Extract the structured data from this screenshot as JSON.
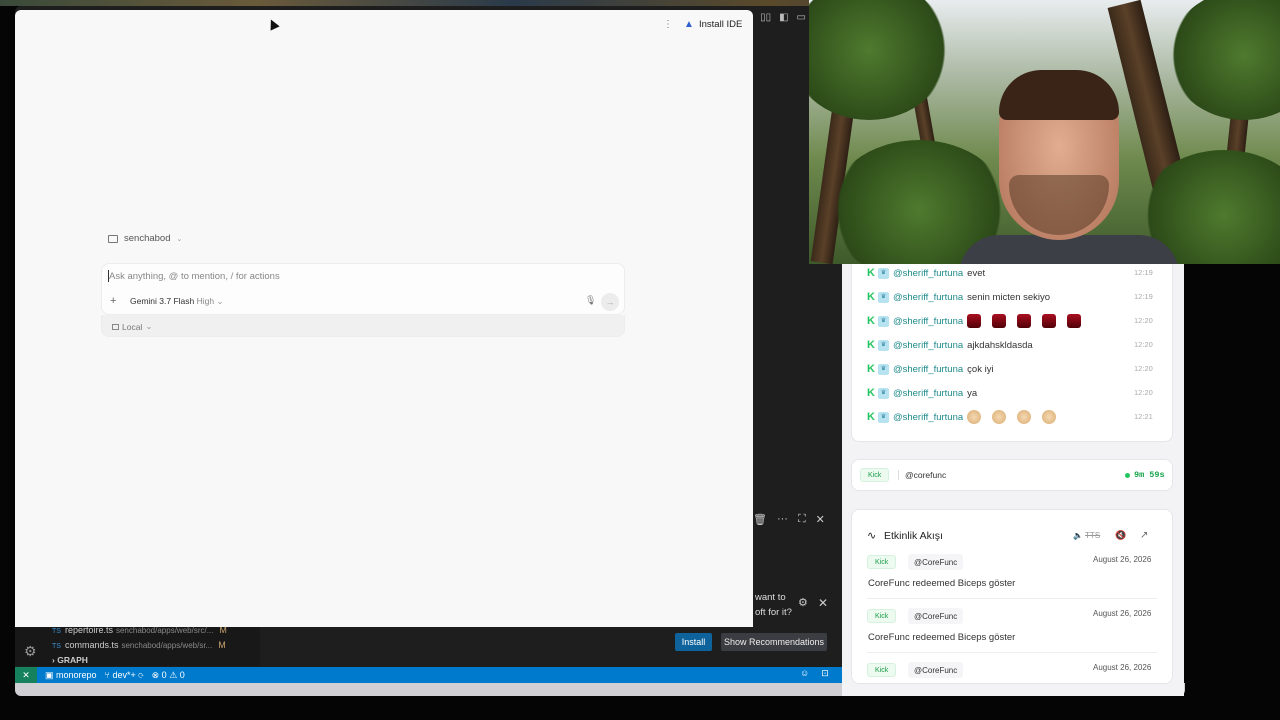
{
  "ai_window": {
    "menu_icon": "kebab-icon",
    "install_ide_label": "Install IDE",
    "workspace_name": "senchabod",
    "prompt_placeholder": "Ask anything, @ to mention, / for actions",
    "model_name": "Gemini 3.7 Flash",
    "model_level": "High",
    "local_label": "Local"
  },
  "vscode": {
    "files": [
      {
        "name": "repertoire.ts",
        "path": "senchabod/apps/web/src/...",
        "status": "M"
      },
      {
        "name": "commands.ts",
        "path": "senchabod/apps/web/sr...",
        "status": "M"
      }
    ],
    "graph_label": "GRAPH",
    "file_type_label": "TS",
    "status_bar": {
      "repo": "monorepo",
      "branch": "dev*+",
      "problems": "⊗ 0 ⚠ 0"
    },
    "notification_text_1": "want to",
    "notification_text_2": "oft for it?",
    "install_button": "Install",
    "show_recommendations_button": "Show Recommendations"
  },
  "chat": {
    "platform_badge": "K",
    "messages": [
      {
        "user": "@sheriff_furtuna",
        "text": "evet",
        "time": "12:19",
        "emotes": 0,
        "emote_kind": ""
      },
      {
        "user": "@sheriff_furtuna",
        "text": "senin micten sekiyo",
        "time": "12:19",
        "emotes": 0,
        "emote_kind": ""
      },
      {
        "user": "@sheriff_furtuna",
        "text": "",
        "time": "12:20",
        "emotes": 5,
        "emote_kind": "red"
      },
      {
        "user": "@sheriff_furtuna",
        "text": "ajkdahskldasda",
        "time": "12:20",
        "emotes": 0,
        "emote_kind": ""
      },
      {
        "user": "@sheriff_furtuna",
        "text": "çok iyi",
        "time": "12:20",
        "emotes": 0,
        "emote_kind": ""
      },
      {
        "user": "@sheriff_furtuna",
        "text": "ya",
        "time": "12:20",
        "emotes": 0,
        "emote_kind": ""
      },
      {
        "user": "@sheriff_furtuna",
        "text": "",
        "time": "12:21",
        "emotes": 4,
        "emote_kind": "face"
      }
    ]
  },
  "stream_status": {
    "platform": "Kick",
    "user": "@corefunc",
    "uptime": "9m 59s"
  },
  "activity": {
    "title": "Etkinlik Akışı",
    "tts_label": "TTS",
    "events": [
      {
        "platform": "Kick",
        "user": "@CoreFunc",
        "date": "August 26, 2026",
        "text": "CoreFunc redeemed Biceps göster"
      },
      {
        "platform": "Kick",
        "user": "@CoreFunc",
        "date": "August 26, 2026",
        "text": "CoreFunc redeemed Biceps göster"
      },
      {
        "platform": "Kick",
        "user": "@CoreFunc",
        "date": "August 26, 2026",
        "text": ""
      }
    ]
  }
}
